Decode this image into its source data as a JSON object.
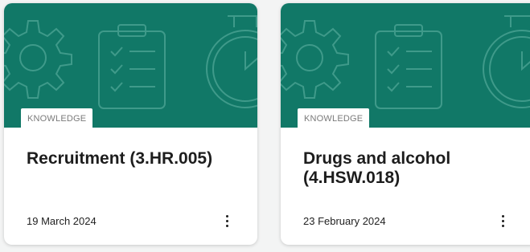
{
  "colors": {
    "banner": "#117867",
    "tag_text": "#7a7a7a"
  },
  "cards": [
    {
      "tag": "KNOWLEDGE",
      "title": "Recruitment (3.HR.005)",
      "date": "19 March 2024",
      "icons": [
        "gear-icon",
        "clipboard-icon",
        "clock-icon",
        "more-vertical-icon"
      ]
    },
    {
      "tag": "KNOWLEDGE",
      "title": "Drugs and alcohol (4.HSW.018)",
      "date": "23 February 2024",
      "icons": [
        "gear-icon",
        "clipboard-icon",
        "clock-icon",
        "more-vertical-icon"
      ]
    }
  ]
}
